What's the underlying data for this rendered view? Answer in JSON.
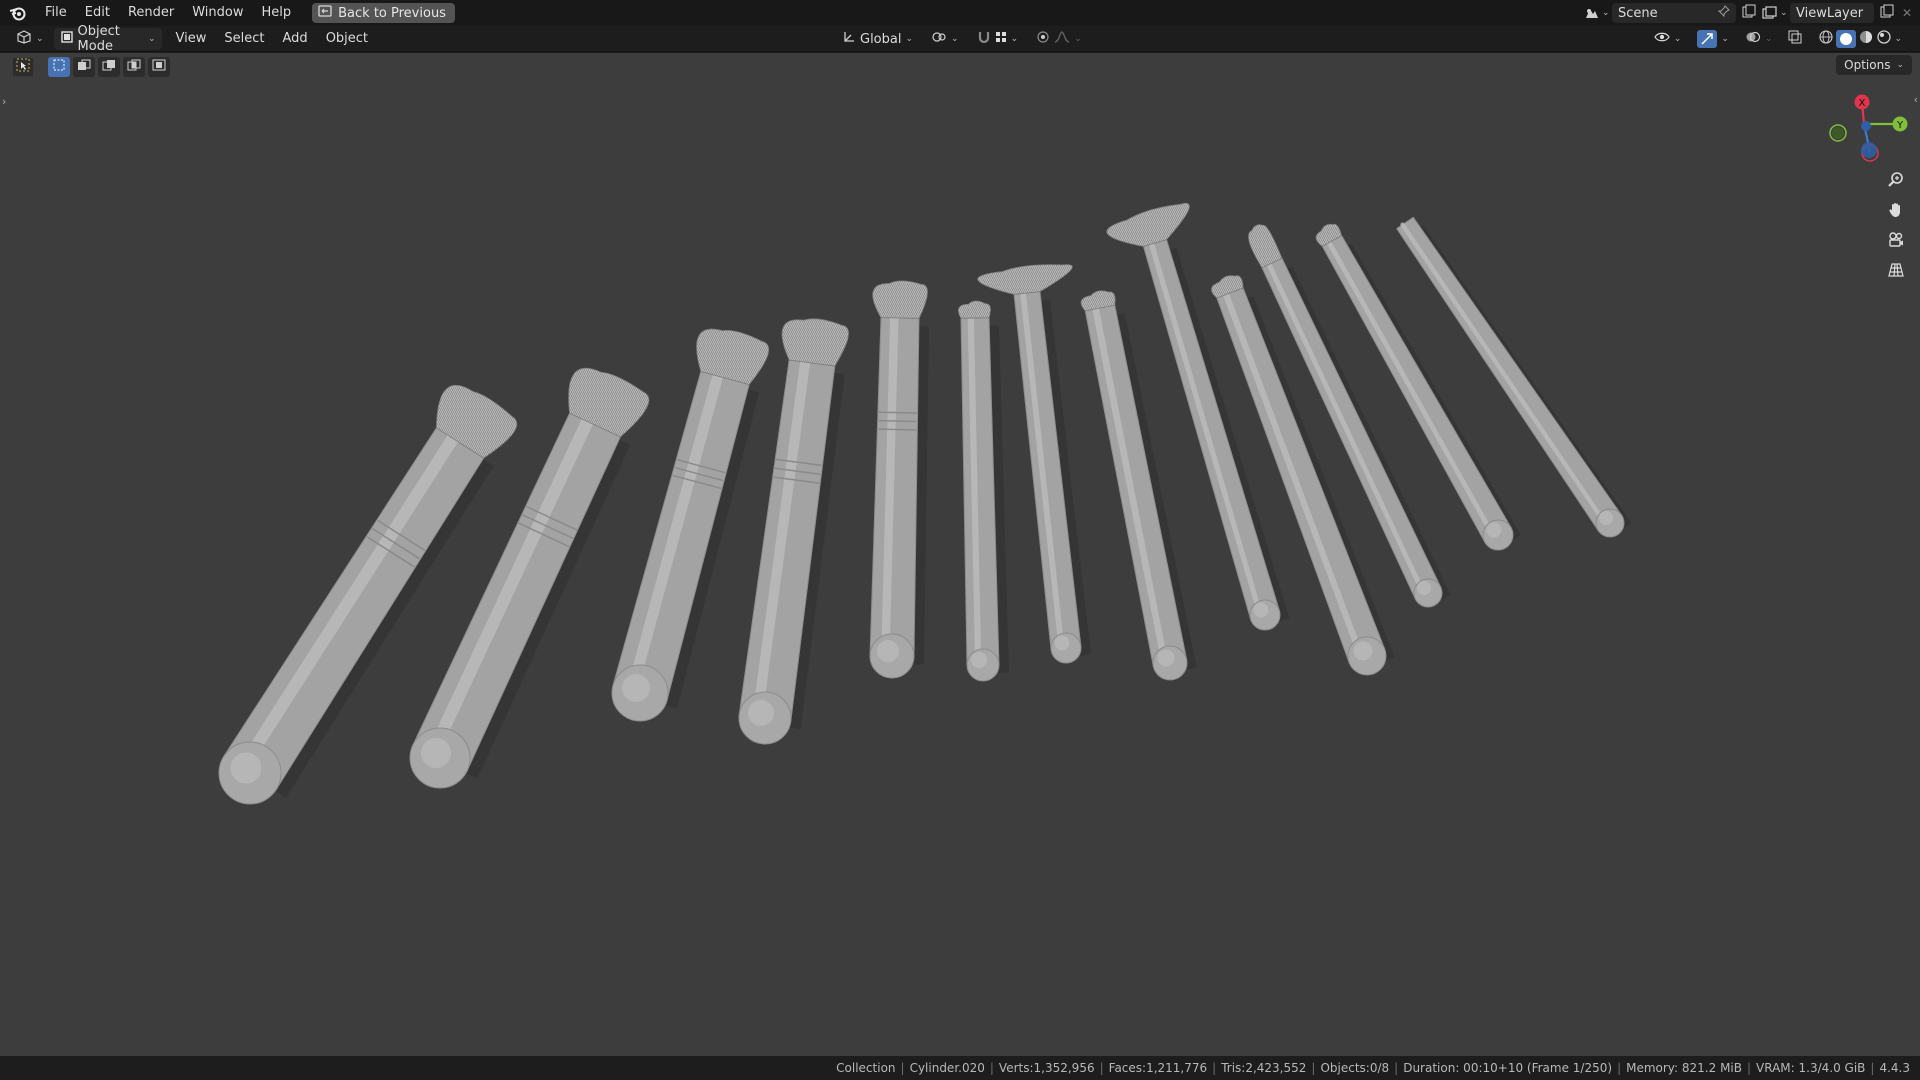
{
  "topbar": {
    "menus": [
      "File",
      "Edit",
      "Render",
      "Window",
      "Help"
    ],
    "back_label": "Back to Previous",
    "scene_name": "Scene",
    "viewlayer_name": "ViewLayer"
  },
  "header": {
    "mode_label": "Object Mode",
    "menus": [
      "View",
      "Select",
      "Add",
      "Object"
    ],
    "transform_orientation": "Global",
    "options_label": "Options"
  },
  "gizmo": {
    "x_label": "X",
    "y_label": "Y"
  },
  "status": {
    "collection": "Collection",
    "object": "Cylinder.020",
    "verts": "Verts:1,352,956",
    "faces": "Faces:1,211,776",
    "tris": "Tris:2,423,552",
    "objects": "Objects:0/8",
    "duration": "Duration: 00:10+10 (Frame 1/250)",
    "memory": "Memory: 821.2 MiB",
    "vram": "VRAM: 1.3/4.0 GiB",
    "version": "4.4.3"
  },
  "colors": {
    "viewport_bg": "#3d3d3d",
    "brush_body": "#a3a3a3",
    "axis_x": "#e0364d",
    "axis_y": "#7fbf3a",
    "axis_z": "#3a7ad8",
    "accent": "#4772b3"
  }
}
